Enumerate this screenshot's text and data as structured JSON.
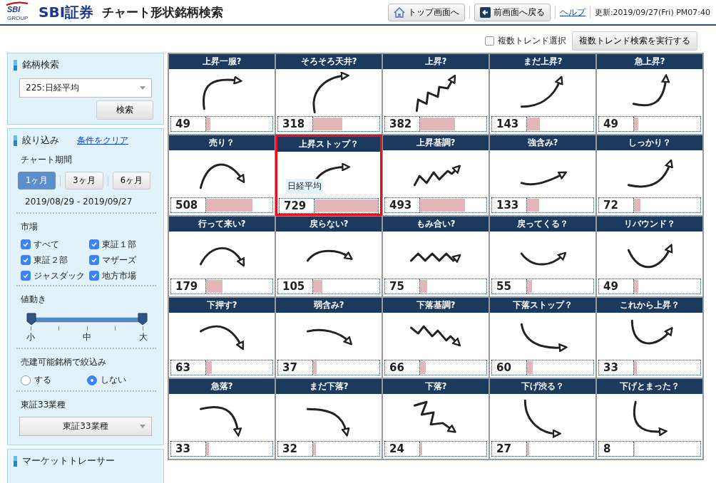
{
  "header": {
    "logo_mark": "SBI",
    "logo_sub": "GROUP",
    "brand": "SBI証券",
    "title": "チャート形状銘柄検索",
    "buttons": [
      {
        "label": "トップ画面へ"
      },
      {
        "label": "前画面へ戻る"
      }
    ],
    "help_link": "ヘルプ",
    "updated": "更新:2019/09/27(Fri) PM07:40"
  },
  "toolbar": {
    "multi_trend": {
      "label": "複数トレンド選択",
      "checked": false
    },
    "run_button": "複数トレンド検索を実行する"
  },
  "sidebar": {
    "search": {
      "title": "銘柄検索",
      "select_value": "225:日経平均",
      "button": "検索"
    },
    "filter": {
      "title": "絞り込み",
      "clear_link": "条件をクリア",
      "period_label": "チャート期間",
      "periods": [
        {
          "label": "1ヶ月",
          "selected": true
        },
        {
          "label": "3ヶ月",
          "selected": false
        },
        {
          "label": "6ヶ月",
          "selected": false
        }
      ],
      "date_range": "2019/08/29 - 2019/09/27",
      "market_label": "市場",
      "markets": [
        {
          "label": "すべて",
          "checked": true
        },
        {
          "label": "東証１部",
          "checked": true
        },
        {
          "label": "東証２部",
          "checked": true
        },
        {
          "label": "マザーズ",
          "checked": true
        },
        {
          "label": "ジャスダック",
          "checked": true
        },
        {
          "label": "地方市場",
          "checked": true
        }
      ],
      "movement_label": "値動き",
      "movement_slider": {
        "thumbs": [
          {
            "level": 0
          },
          {
            "level": 1
          }
        ],
        "tick_labels": [
          "小",
          "中",
          "大"
        ]
      },
      "short_label": "売建可能銘柄で絞込み",
      "short_options": [
        {
          "label": "する",
          "selected": false
        },
        {
          "label": "しない",
          "selected": true
        }
      ],
      "sector_label": "東証33業種",
      "sector_select": "東証33業種"
    },
    "tracer": {
      "title": "マーケットトレーサー"
    }
  },
  "cells": [
    {
      "title": "上昇一服?",
      "count": "49",
      "level": 0.067,
      "kind": "rise-pause",
      "selected": false
    },
    {
      "title": "そろそろ天井?",
      "count": "318",
      "level": 0.436,
      "kind": "near-top",
      "selected": false
    },
    {
      "title": "上昇?",
      "count": "382",
      "level": 0.524,
      "kind": "zigzag-up",
      "selected": false
    },
    {
      "title": "まだ上昇?",
      "count": "143",
      "level": 0.196,
      "kind": "still-up",
      "selected": false
    },
    {
      "title": "急上昇?",
      "count": "49",
      "level": 0.067,
      "kind": "sharp-up",
      "selected": false
    },
    {
      "title": "売り？",
      "count": "508",
      "level": 0.697,
      "kind": "sell-arch",
      "selected": false
    },
    {
      "title": "上昇ストップ？",
      "count": "729",
      "level": 1,
      "kind": "rise-stop",
      "selected": true,
      "overlay_label": "日経平均"
    },
    {
      "title": "上昇基調?",
      "count": "493",
      "level": 0.676,
      "kind": "zigzag-trend-up",
      "selected": false
    },
    {
      "title": "強含み?",
      "count": "133",
      "level": 0.182,
      "kind": "firm",
      "selected": false
    },
    {
      "title": "しっかり？",
      "count": "72",
      "level": 0.099,
      "kind": "solid-up",
      "selected": false
    },
    {
      "title": "行って来い?",
      "count": "179",
      "level": 0.246,
      "kind": "round-trip",
      "selected": false
    },
    {
      "title": "戻らない?",
      "count": "105",
      "level": 0.144,
      "kind": "flat-arch",
      "selected": false
    },
    {
      "title": "もみ合い?",
      "count": "75",
      "level": 0.103,
      "kind": "zigzag-flat",
      "selected": false
    },
    {
      "title": "戻ってくる？",
      "count": "55",
      "level": 0.075,
      "kind": "dip",
      "selected": false
    },
    {
      "title": "リバウンド？",
      "count": "49",
      "level": 0.067,
      "kind": "rebound",
      "selected": false
    },
    {
      "title": "下押す?",
      "count": "63",
      "level": 0.086,
      "kind": "push-down",
      "selected": false
    },
    {
      "title": "弱含み?",
      "count": "37",
      "level": 0.051,
      "kind": "weak",
      "selected": false
    },
    {
      "title": "下落基調?",
      "count": "66",
      "level": 0.091,
      "kind": "zigzag-trend-down",
      "selected": false
    },
    {
      "title": "下落ストップ？",
      "count": "60",
      "level": 0.082,
      "kind": "fall-stop",
      "selected": false
    },
    {
      "title": "これから上昇？",
      "count": "33",
      "level": 0.045,
      "kind": "turn-up",
      "selected": false
    },
    {
      "title": "急落?",
      "count": "33",
      "level": 0.045,
      "kind": "plunge",
      "selected": false
    },
    {
      "title": "まだ下落?",
      "count": "32",
      "level": 0.044,
      "kind": "still-down",
      "selected": false
    },
    {
      "title": "下落?",
      "count": "24",
      "level": 0.033,
      "kind": "zigzag-down",
      "selected": false
    },
    {
      "title": "下げ渋る？",
      "count": "27",
      "level": 0.037,
      "kind": "bottoming",
      "selected": false
    },
    {
      "title": "下げとまった？",
      "count": "8",
      "level": 0.011,
      "kind": "stopped",
      "selected": false
    }
  ]
}
